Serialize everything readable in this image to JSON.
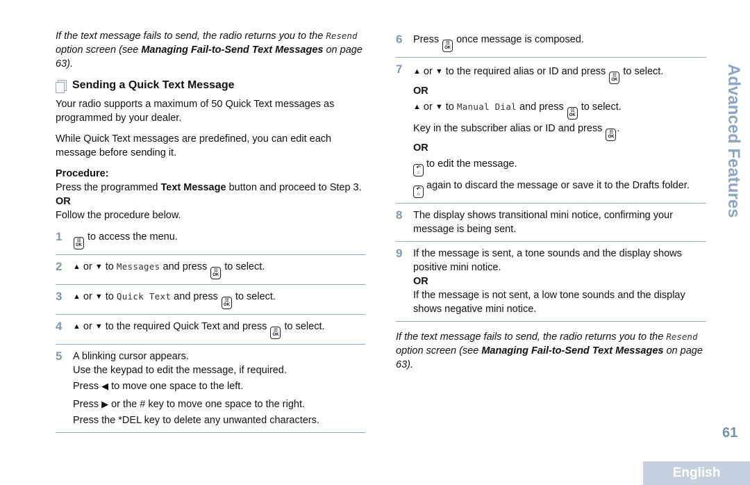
{
  "left_column": {
    "intro_note": {
      "part1": "If the text message fails to send, the radio returns you to the ",
      "ui_word": "Resend",
      "part2": " option screen (see ",
      "link_bold_1": "Managing Fail-to-Send Text",
      "link_bold_2": "Messages",
      "part3": " on page 63)."
    },
    "section_title": "Sending a Quick Text Message",
    "section_icon": "document-pages-icon",
    "para1": "Your radio supports a maximum of 50 Quick Text messages as programmed by your dealer.",
    "para2": "While Quick Text messages are predefined, you can edit each message before sending it.",
    "procedure_label": "Procedure:",
    "procedure_text_1": "Press the programmed ",
    "procedure_text_bold": "Text Message",
    "procedure_text_2": " button and proceed to Step 3.",
    "or": "OR",
    "follow_text": "Follow the procedure below.",
    "steps": [
      {
        "num": "1",
        "text_after_key": " to access the menu."
      },
      {
        "num": "2",
        "or": " or ",
        "to": " to ",
        "ui": "Messages",
        "press": " and press ",
        "end": " to select."
      },
      {
        "num": "3",
        "or": " or ",
        "to": " to ",
        "ui": "Quick Text",
        "press": " and press ",
        "end": " to select."
      },
      {
        "num": "4",
        "or": " or ",
        "to_text": " to the required Quick Text and press ",
        "end": " to select."
      },
      {
        "num": "5",
        "line1": "A blinking cursor appears.",
        "line2": "Use the keypad to edit the message, if required.",
        "line3_a": "Press ",
        "line3_b": " to move one space to the left.",
        "line4_a": "Press ",
        "line4_b": " or the # key to move one space to the right.",
        "line5": "Press the *DEL key to delete any unwanted characters."
      }
    ]
  },
  "right_column": {
    "steps": [
      {
        "num": "6",
        "a": "Press ",
        "b": " once message is composed."
      },
      {
        "num": "7",
        "l1_or": " or ",
        "l1_text": " to the required alias or ID and press ",
        "l1_end": " to select.",
        "or1": "OR",
        "l2_or": " or ",
        "l2_to": " to ",
        "l2_ui": "Manual Dial",
        "l2_press": " and press ",
        "l2_end": " to select.",
        "l3_a": "Key in the subscriber alias or ID and press ",
        "l3_end": ".",
        "or2": "OR",
        "l4": " to edit the message.",
        "l5": " again to discard the message or save it to the Drafts folder."
      },
      {
        "num": "8",
        "text": "The display shows transitional mini notice, confirming your message is being sent."
      },
      {
        "num": "9",
        "l1": "If the message is sent, a tone sounds and the display shows positive mini notice.",
        "or": "OR",
        "l2": "If the message is not sent, a low tone sounds and the display shows negative mini notice."
      }
    ],
    "outro_note": {
      "part1": "If the text message fails to send, the radio returns you to the ",
      "ui_word": "Resend",
      "part2": " option screen (see ",
      "link_bold_1": "Managing Fail-to-Send Text",
      "link_bold_2": "Messages",
      "part3": " on page 63)."
    }
  },
  "keys": {
    "ok_top": "☷",
    "ok_label": "OK",
    "back_top": "↶",
    "back_bottom": "⌂",
    "up_arrow": "▲",
    "down_arrow": "▼",
    "left_arrow": "◀",
    "right_arrow": "▶"
  },
  "side_tab": "Advanced Features",
  "page_number": "61",
  "language_tab": "English",
  "colors": {
    "step_number": "#7e9ab3",
    "divider": "#8fa9bd",
    "side_tab": "#8aa7c4",
    "page_number": "#7591ab",
    "language_tab_bg": "#c5d1de"
  }
}
